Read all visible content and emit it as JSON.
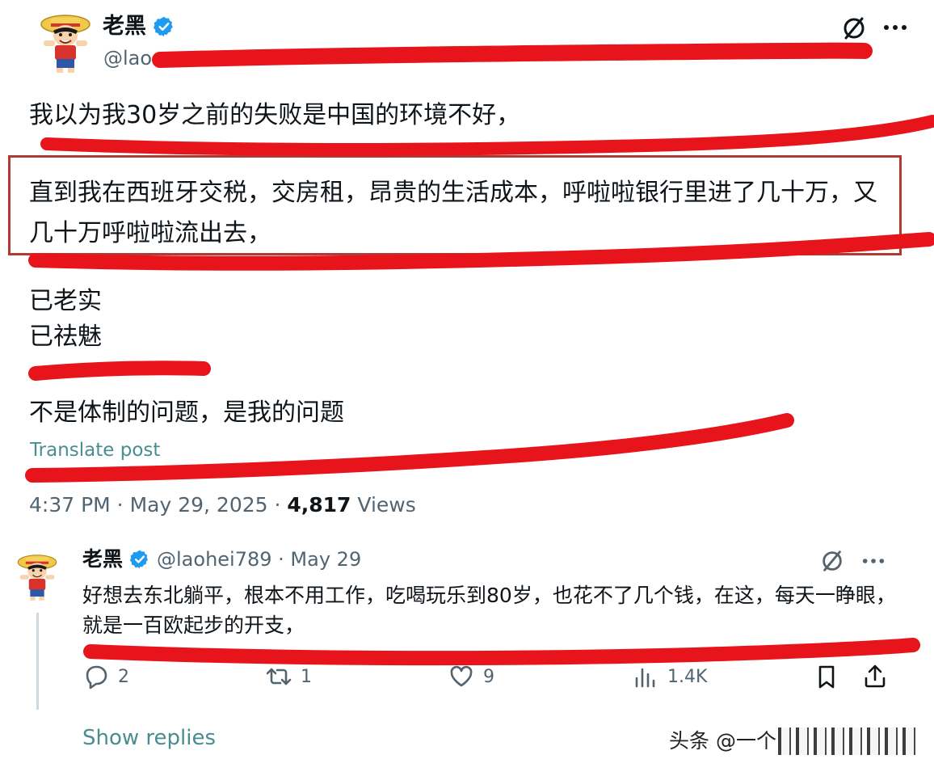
{
  "post": {
    "author_name": "老黑",
    "handle_visible": "@lao",
    "lines": [
      "我以为我30岁之前的失败是中国的环境不好，",
      "直到我在西班牙交税，交房租，昂贵的生活成本，呼啦啦银行里进了几十万，又几十万呼啦啦流出去，",
      "已老实",
      "已祛魅",
      "不是体制的问题，是我的问题"
    ],
    "translate_label": "Translate post",
    "time": "4:37 PM · May 29, 2025 · ",
    "views_count": "4,817",
    "views_label": " Views"
  },
  "reply": {
    "author_name": "老黑",
    "handle": "@laohei789",
    "separator": " · ",
    "date": "May 29",
    "text": "好想去东北躺平，根本不用工作，吃喝玩乐到80岁，也花不了几个钱，在这，每天一睁眼，就是一百欧起步的开支，",
    "actions": {
      "replies": "2",
      "reposts": "1",
      "likes": "9",
      "views": "1.4K"
    },
    "show_replies_label": "Show replies"
  },
  "watermark": {
    "text": "头条 @一个"
  },
  "colors": {
    "marker": "#e8141c",
    "verified": "#1d9bf0",
    "link": "#4a8d90",
    "secondary_text": "#536471"
  },
  "icons": [
    "avatar-luffy-icon",
    "verified-badge-icon",
    "grok-icon",
    "more-icon",
    "reply-icon",
    "repost-icon",
    "like-icon",
    "views-icon",
    "bookmark-icon",
    "share-icon"
  ]
}
